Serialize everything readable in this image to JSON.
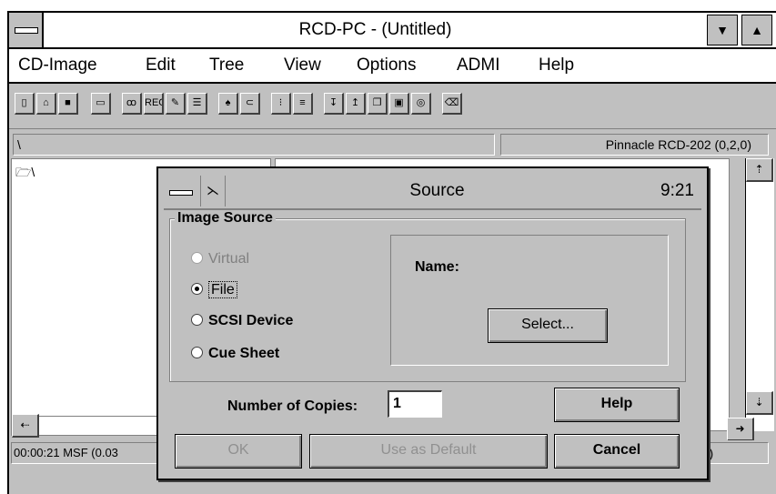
{
  "window": {
    "title": "RCD-PC - (Untitled)"
  },
  "menu": [
    "CD-Image",
    "Edit",
    "Tree",
    "View",
    "Options",
    "ADMI",
    "Help"
  ],
  "toolbar": {
    "rec_label": "REC"
  },
  "pathbar": {
    "path": "\\",
    "device": "Pinnacle RCD-202 (0,2,0)"
  },
  "tree": {
    "root": "\\"
  },
  "status": {
    "left": "00:00:21 MSF (0.03",
    "right": "cted)"
  },
  "dialog": {
    "title": "Source",
    "time": "9:21",
    "group_label": "Image Source",
    "options": [
      {
        "label": "Virtual",
        "selected": false,
        "enabled": false
      },
      {
        "label": "File",
        "selected": true,
        "enabled": true
      },
      {
        "label": "SCSI Device",
        "selected": false,
        "enabled": true
      },
      {
        "label": "Cue Sheet",
        "selected": false,
        "enabled": true
      }
    ],
    "name_label": "Name:",
    "select_button": "Select...",
    "copies_label": "Number of Copies:",
    "copies_value": "1",
    "help_button": "Help",
    "ok_button": "OK",
    "default_button": "Use as Default",
    "cancel_button": "Cancel"
  }
}
